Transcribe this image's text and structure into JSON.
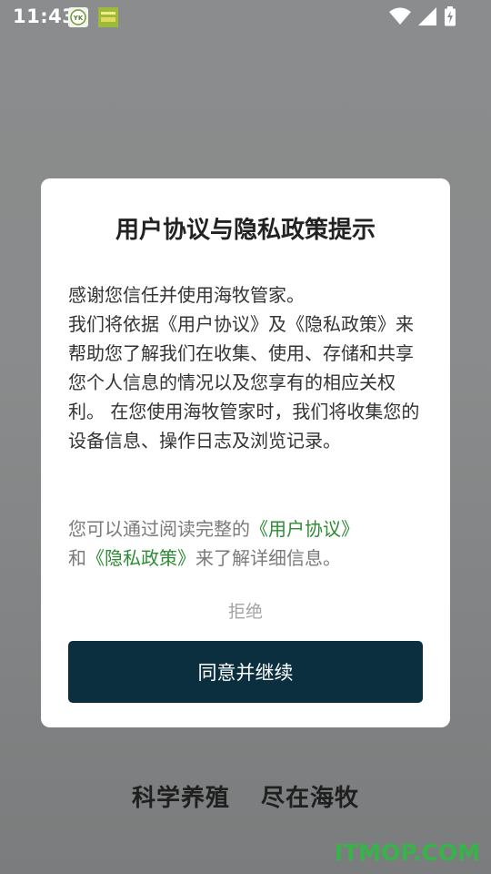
{
  "status_bar": {
    "time": "11:43",
    "notification_icons": [
      "yk-app-icon",
      "farm-app-icon"
    ],
    "system_icons": [
      "wifi-icon",
      "signal-icon",
      "battery-charging-icon"
    ]
  },
  "dialog": {
    "title": "用户协议与隐私政策提示",
    "body_line1": "感谢您信任并使用海牧管家。",
    "body_line2": "我们将依据《用户协议》及《隐私政策》来帮助您了解我们在收集、使用、存储和共享您个人信息的情况以及您享有的相应关权利。 在您使用海牧管家时，我们将收集您的设备信息、操作日志及浏览记录。",
    "hint_prefix": "您可以通过阅读完整的",
    "user_agreement_link": "《用户协议》",
    "hint_and": "和",
    "privacy_policy_link": "《隐私政策》",
    "hint_suffix": "来了解详细信息。",
    "reject_label": "拒绝",
    "agree_label": "同意并继续"
  },
  "slogan": {
    "part1": "科学养殖",
    "part2": "尽在海牧"
  },
  "watermark": "ITMOP.COM",
  "colors": {
    "link": "#2e8b35",
    "primary_button": "#0b2f3e",
    "overlay": "#898b8c"
  }
}
